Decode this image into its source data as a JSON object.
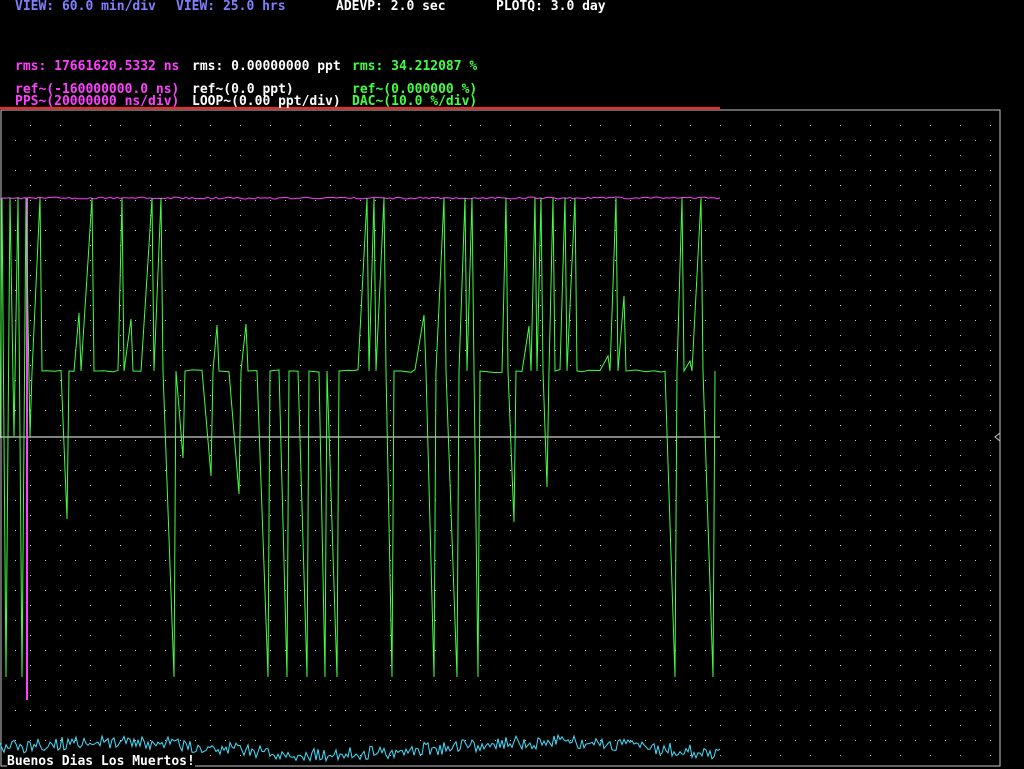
{
  "header": {
    "view_min": "VIEW: 60.0 min/div",
    "view_hrs": "VIEW: 25.0 hrs",
    "adevp": "ADEVP: 2.0 sec",
    "plotq": "PLOTQ: 3.0 day"
  },
  "stats": {
    "rms_pps": "rms: 17661620.5332 ns",
    "rms_loop": "rms: 0.00000000 ppt",
    "rms_dac": "rms: 34.212087 %"
  },
  "refs": {
    "ref_pps": "ref~(-160000000.0 ns)",
    "ref_loop": "ref~(0.0 ppt)",
    "ref_dac": "ref~(0.000000 %)"
  },
  "scales": {
    "pps_scale": "PPS~(20000000 ns/div)",
    "loop_scale": "LOOP~(0.00 ppt/div)",
    "dac_scale": "DAC~(10.0 %/div)"
  },
  "footer": {
    "message": "Buenos Dias Los Muertos!"
  },
  "colors": {
    "background": "#000000",
    "grid": "#c8c8c8",
    "header_text": "#8080ff",
    "white_text": "#ffffff",
    "pps": "#ff40ff",
    "loop": "#ffffff",
    "dac": "#40ff40",
    "cyan_trace": "#40e0ff",
    "marker": "#ff2020"
  },
  "chart_data": {
    "type": "line",
    "x_division": "60.0 min/div",
    "x_span": "25.0 hrs",
    "grid": true,
    "series": [
      {
        "name": "PPS",
        "scale": "20000000 ns/div",
        "ref": "-160000000.0 ns",
        "rms": "17661620.5332 ns"
      },
      {
        "name": "LOOP",
        "scale": "0.00 ppt/div",
        "ref": "0.0 ppt",
        "rms": "0.00000000 ppt"
      },
      {
        "name": "DAC",
        "scale": "10.0 %/div",
        "ref": "0.000000 %",
        "rms": "34.212087 %"
      }
    ]
  }
}
